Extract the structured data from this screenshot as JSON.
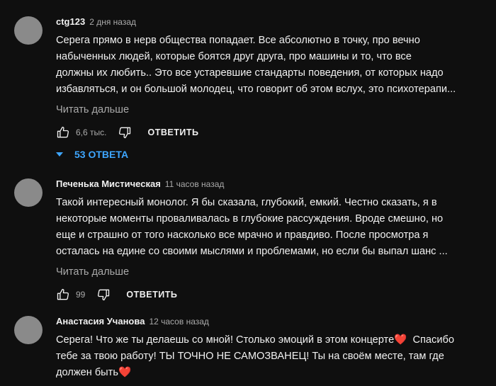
{
  "comments": [
    {
      "author": "ctg123",
      "time": "2 дня назад",
      "lines": [
        "Серега прямо в нерв общества попадает. Все абсолютно в точку, про вечно",
        "набыченных людей, которые боятся друг друга, про машины и то, что  все",
        "должны их любить.. Это все устаревшие стандарты поведения, от которых надо",
        "избавляться, и он большой молодец, что говорит об этом вслух, это психотерапи..."
      ],
      "read_more": "Читать дальше",
      "likes": "6,6 тыс.",
      "reply_label": "ОТВЕТИТЬ",
      "replies_label": "53 ОТВЕТА"
    },
    {
      "author": "Печенька Мистическая",
      "time": "11 часов назад",
      "lines": [
        "Такой интересный монолог.  Я бы сказала, глубокий, емкий. Честно сказать, я в",
        "некоторые моменты проваливалась в глубокие рассуждения. Вроде смешно, но",
        "еще и страшно от того насколько все мрачно и правдиво. После просмотра я",
        "осталась на едине со своими мыслями и проблемами, но если бы выпал шанс ..."
      ],
      "read_more": "Читать дальше",
      "likes": "99",
      "reply_label": "ОТВЕТИТЬ"
    },
    {
      "author": "Анастасия Учанова",
      "time": "12 часов назад",
      "lines": [
        "Серега! Что же ты делаешь со мной! Столько эмоций в этом концерте",
        "тебе за твою работу! ТЫ ТОЧНО НЕ САМОЗВАНЕЦ! Ты на своём месте, там где",
        "должен быть"
      ],
      "line1_suffix": "  Спасибо",
      "heart": "❤️"
    }
  ],
  "colors": {
    "background": "#0f0f0f",
    "text": "#f1f1f1",
    "secondary_text": "#aaaaaa",
    "replies_link": "#3ea6ff",
    "avatar": "#8a8a8a",
    "heart": "#e53935"
  },
  "icons": {
    "like": "thumb-up-icon",
    "dislike": "thumb-down-icon",
    "replies": "caret-down-icon",
    "heart": "heart-emoji"
  }
}
